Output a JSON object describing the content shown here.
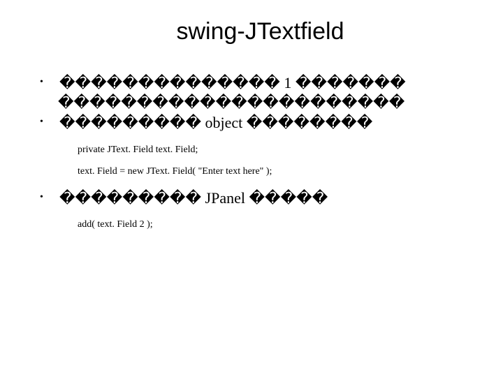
{
  "title": "swing-JTextfield",
  "bullets": {
    "b1_line1": "�������������� 1 �������",
    "b1_line2": "����������������������",
    "b2": "��������� object ��������",
    "b3": "��������� JPanel �����"
  },
  "code": {
    "decl": "private JText. Field text. Field;",
    "inst": "text. Field = new JText. Field( \"Enter text here\" );",
    "add": "add( text. Field 2 );"
  }
}
